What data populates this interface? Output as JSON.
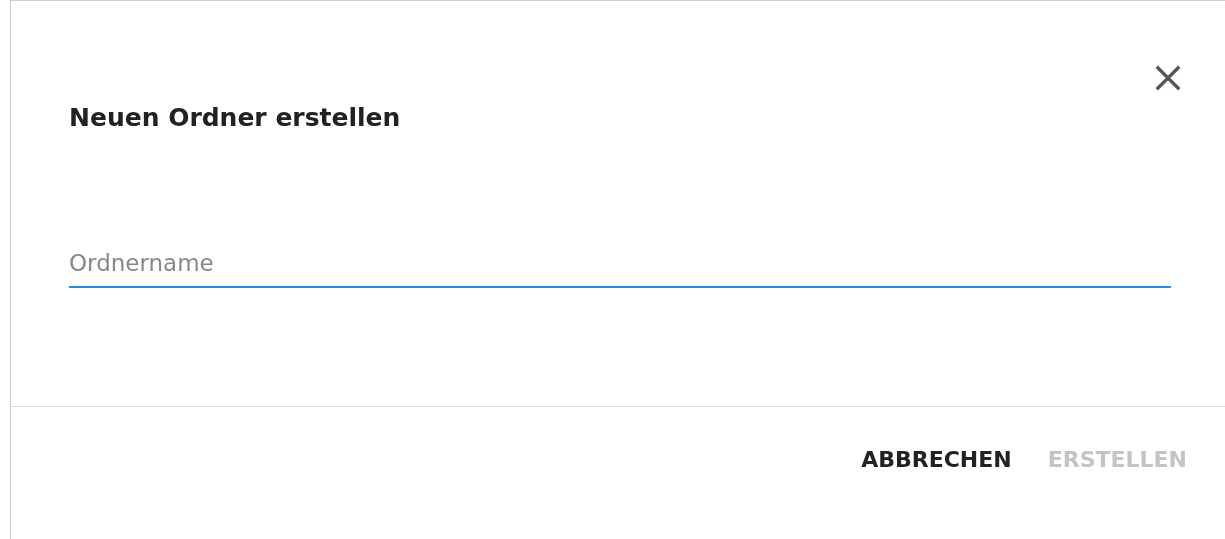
{
  "dialog": {
    "title": "Neuen Ordner erstellen",
    "field": {
      "placeholder": "Ordnername",
      "focused": true
    },
    "buttons": [
      {
        "label": "ABBRECHEN",
        "disabled": false
      },
      {
        "label": "ERSTELLEN",
        "disabled": true
      }
    ]
  }
}
